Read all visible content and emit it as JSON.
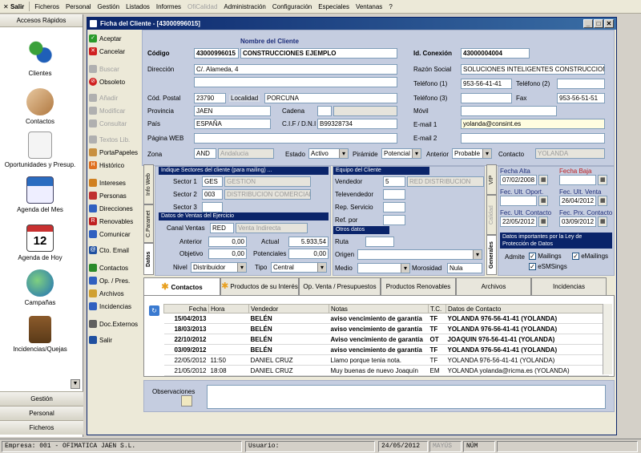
{
  "menubar": {
    "salir": "Salir",
    "items": [
      "Ficheros",
      "Personal",
      "Gestión",
      "Listados",
      "Informes",
      "OfiCalidad",
      "Administración",
      "Configuración",
      "Especiales",
      "Ventanas",
      "?"
    ]
  },
  "left": {
    "title": "Accesos Rápidos",
    "items": [
      "Clientes",
      "Contactos",
      "Oportunidades y Presup.",
      "Agenda del Mes",
      "Agenda de Hoy",
      "Campañas",
      "Incidencias/Quejas"
    ],
    "calendar_day": "12",
    "bottom": [
      "Gestión",
      "Personal",
      "Ficheros"
    ]
  },
  "window": {
    "title": "Ficha del Cliente - [43000996015]"
  },
  "actions": [
    "Aceptar",
    "Cancelar",
    "Buscar",
    "Obsoleto",
    "Añadir",
    "Modificar",
    "Consultar",
    "Textos Lib.",
    "PortaPapeles",
    "Histórico",
    "Intereses",
    "Personas",
    "Direcciones",
    "Renovables",
    "Comunicar",
    "Cto. Email",
    "Contactos",
    "Op. / Pres.",
    "Archivos",
    "Incidencias",
    "Doc.Externos",
    "Salir"
  ],
  "form": {
    "nombre_header": "Nombre del Cliente",
    "codigo_label": "Código",
    "codigo": "43000996015",
    "nombre": "CONSTRUCCIONES EJEMPLO",
    "idconexion_label": "Id. Conexión",
    "idconexion": "43000004004",
    "direccion_label": "Dirección",
    "direccion": "C/. Alameda, 4",
    "razon_label": "Razón Social",
    "razon": "SOLUCIONES INTELIGENTES CONSTRUCCION, SL",
    "tel1_label": "Teléfono (1)",
    "tel1": "953-56-41-41",
    "tel2_label": "Teléfono (2)",
    "tel2": "",
    "tel3_label": "Teléfono (3)",
    "tel3": "",
    "fax_label": "Fax",
    "fax": "953-56-51-51",
    "cp_label": "Cód. Postal",
    "cp": "23790",
    "localidad_label": "Localidad",
    "localidad": "PORCUNA",
    "provincia_label": "Provincia",
    "provincia": "JAEN",
    "cadena_label": "Cadena",
    "movil_label": "Móvil",
    "pais_label": "País",
    "pais": "ESPAÑA",
    "cif_label": "C.I.F / D.N.I",
    "cif": "B99328734",
    "email1_label": "E-mail 1",
    "email1": "yolanda@consint.es",
    "web_label": "Página WEB",
    "email2_label": "E-mail 2",
    "zona_label": "Zona",
    "zona": "AND",
    "zona_desc": "Andalucia",
    "estado_label": "Estado",
    "estado": "Activo",
    "piramide_label": "Pirámide",
    "piramide": "Potencial",
    "anterior_label": "Anterior",
    "anterior": "Probable",
    "contacto_label": "Contacto",
    "contacto": "YOLANDA"
  },
  "vtabs": [
    "Info Web",
    "C.Paramet",
    "Datos",
    "VIP",
    "Calidad",
    "Generales"
  ],
  "sectores": {
    "header": "Indique Sectores del cliente (para mailing) ...",
    "s1_label": "Sector 1",
    "s1": "GES",
    "s1_desc": "GESTION",
    "s2_label": "Sector 2",
    "s2": "003",
    "s2_desc": "DISTRIBUCION COMERCIAL",
    "s3_label": "Sector 3"
  },
  "equipo": {
    "header": "Equipo del Cliente",
    "vend_label": "Vendedor",
    "vend": "5",
    "vend_desc": "RED DISTRIBUCION",
    "tele_label": "Televendedor",
    "rep_label": "Rep. Servicio",
    "ref_label": "Ref. por"
  },
  "ventas": {
    "header": "Datos de Ventas del Ejercicio",
    "canal_label": "Canal Ventas",
    "canal": "RED",
    "canal_desc": "Venta Indirecta",
    "anterior_label": "Anterior",
    "anterior": "0,00",
    "actual_label": "Actual",
    "actual": "5.933,54",
    "objetivo_label": "Objetivo",
    "objetivo": "0,00",
    "potenciales_label": "Potenciales",
    "potenciales": "0,00",
    "nivel_label": "Nivel",
    "nivel": "Distribuidor",
    "tipo_label": "Tipo",
    "tipo": "Central"
  },
  "otros": {
    "header": "Otros datos",
    "ruta_label": "Ruta",
    "origen_label": "Origen",
    "medio_label": "Medio",
    "morosidad_label": "Morosidad",
    "morosidad": "Nula"
  },
  "fechas": {
    "alta_label": "Fecha Alta",
    "alta": "07/02/2008",
    "baja_label": "Fecha Baja",
    "ult_oport_label": "Fec. Ult. Oport.",
    "ult_venta_label": "Fec. Ult. Venta",
    "ult_venta": "26/04/2012",
    "ult_contacto_label": "Fec. Ult. Contacto",
    "ult_contacto": "22/05/2012",
    "prx_contacto_label": "Fec. Prx. Contacto",
    "prx_contacto": "03/09/2012"
  },
  "lopd": {
    "header": "Datos importantes por la Ley de Protección de Datos",
    "admite": "Admite",
    "mailings": "Mailings",
    "emailings": "eMailings",
    "esms": "eSMSings"
  },
  "tabs": [
    "Contactos",
    "Productos de su Interés",
    "Op. Venta / Presupuestos",
    "Productos Renovables",
    "Archivos",
    "Incidencias"
  ],
  "table": {
    "columns": [
      "Fecha",
      "Hora",
      "Vendedor",
      "Notas",
      "T.C.",
      "Datos de Contacto"
    ],
    "rows": [
      [
        "15/04/2013",
        "",
        "BELÉN",
        "aviso vencimiento de garantía",
        "TF",
        "YOLANDA 976-56-41-41 (YOLANDA)"
      ],
      [
        "18/03/2013",
        "",
        "BELÉN",
        "aviso vencimiento de garantía",
        "TF",
        "YOLANDA 976-56-41-41 (YOLANDA)"
      ],
      [
        "22/10/2012",
        "",
        "BELÉN",
        "Aviso vencimiento de garantía",
        "OT",
        "JOAQUIN 976-56-41-41 (YOLANDA)"
      ],
      [
        "03/09/2012",
        "",
        "BELÉN",
        "aviso vencimiento de garantía",
        "TF",
        "YOLANDA 976-56-41-41 (YOLANDA)"
      ],
      [
        "22/05/2012",
        "11:50",
        "DANIEL CRUZ",
        "Llamo porque tenia nota.",
        "TF",
        "YOLANDA 976-56-41-41 (YOLANDA)"
      ],
      [
        "21/05/2012",
        "18:08",
        "DANIEL CRUZ",
        "Muy buenas de nuevo Joaquín",
        "EM",
        "YOLANDA yolanda@ricma.es (YOLANDA)"
      ]
    ]
  },
  "observaciones_label": "Observaciones",
  "status": {
    "empresa": "Empresa: 001 - OFIMATICA JAEN S.L.",
    "usuario": "Usuario:",
    "fecha": "24/05/2012",
    "mayus": "MAYÚS",
    "num": "NÚM"
  }
}
